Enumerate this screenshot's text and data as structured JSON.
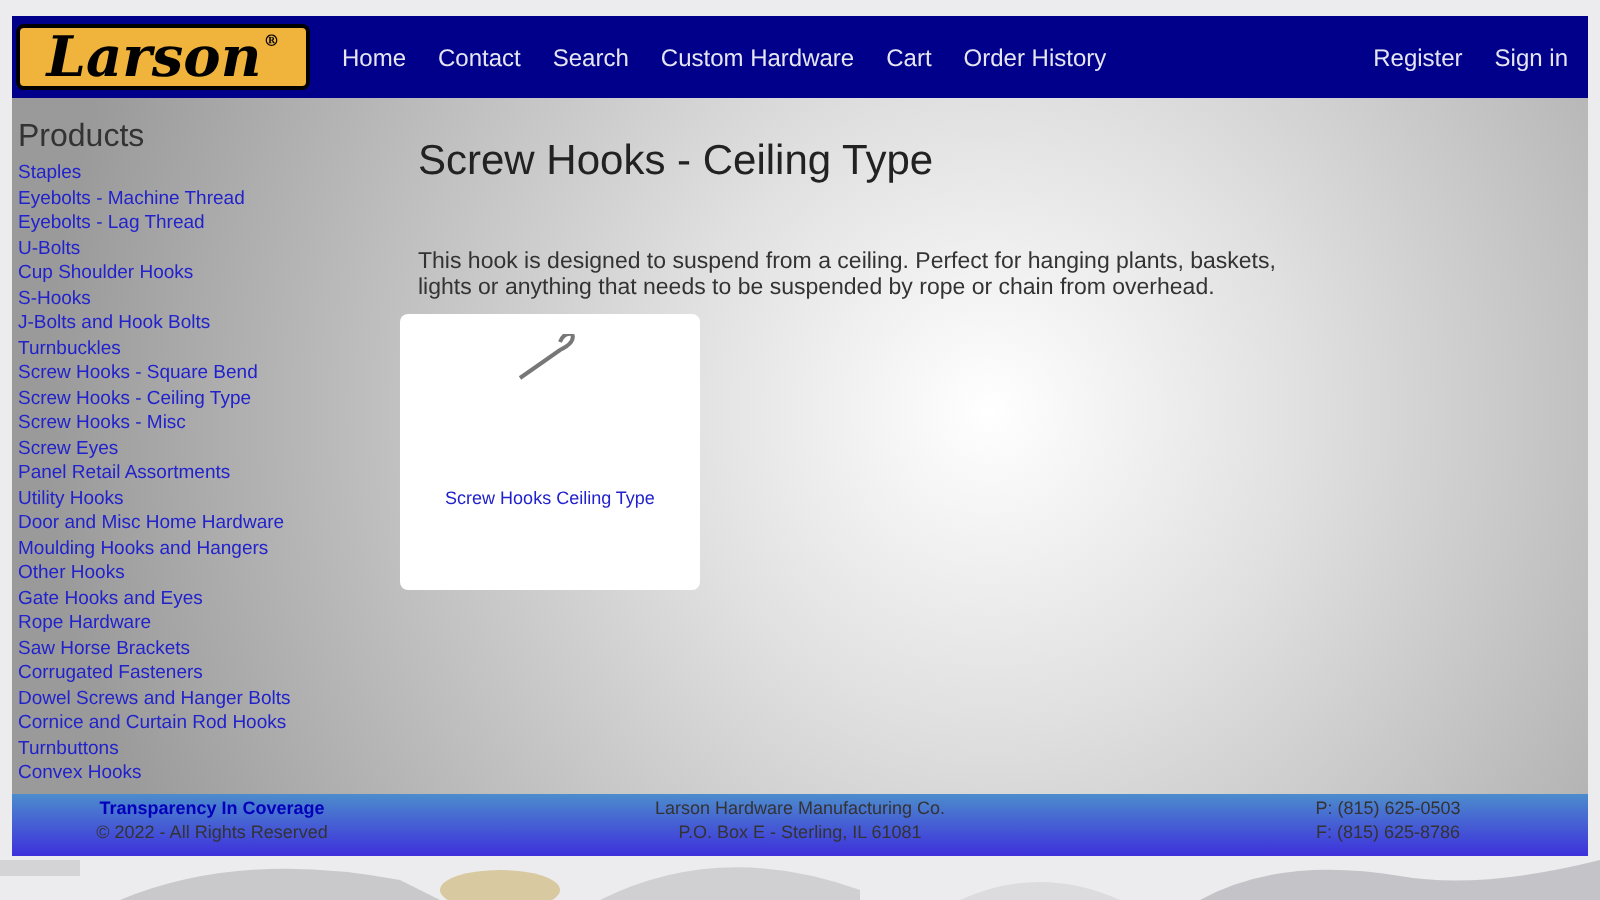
{
  "logo": {
    "text": "Larson",
    "mark": "®"
  },
  "nav": {
    "left": [
      "Home",
      "Contact",
      "Search",
      "Custom Hardware",
      "Cart",
      "Order History"
    ],
    "right": [
      "Register",
      "Sign in"
    ]
  },
  "sidebar": {
    "title": "Products",
    "items": [
      "Staples",
      "Eyebolts - Machine Thread",
      "Eyebolts - Lag Thread",
      "U-Bolts",
      "Cup Shoulder Hooks",
      "S-Hooks",
      "J-Bolts and Hook Bolts",
      "Turnbuckles",
      "Screw Hooks - Square Bend",
      "Screw Hooks - Ceiling Type",
      "Screw Hooks - Misc",
      "Screw Eyes",
      "Panel Retail Assortments",
      "Utility Hooks",
      "Door and Misc Home Hardware",
      "Moulding Hooks and Hangers",
      "Other Hooks",
      "Gate Hooks and Eyes",
      "Rope Hardware",
      "Saw Horse Brackets",
      "Corrugated Fasteners",
      "Dowel Screws and Hanger Bolts",
      "Cornice and Curtain Rod Hooks",
      "Turnbuttons",
      "Convex Hooks"
    ]
  },
  "content": {
    "title": "Screw Hooks - Ceiling Type",
    "description": "This hook is designed to suspend from a ceiling. Perfect for hanging plants, baskets, lights or anything that needs to be suspended by rope or chain from overhead.",
    "products": [
      {
        "name": "Screw Hooks Ceiling Type"
      }
    ]
  },
  "footer": {
    "link": "Transparency In Coverage",
    "copyright": "© 2022 - All Rights Reserved",
    "company": "Larson Hardware Manufacturing Co.",
    "address": "P.O. Box E - Sterling, IL 61081",
    "phone": "P: (815) 625-0503",
    "fax": "F: (815) 625-8786"
  }
}
